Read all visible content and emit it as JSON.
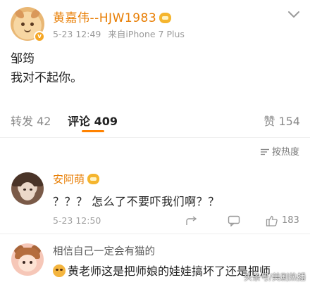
{
  "post": {
    "author_name": "黄嘉伟--HJW1983",
    "timestamp": "5-23 12:49",
    "source": "来自iPhone 7 Plus",
    "body_line1": "邹筠",
    "body_line2": "我对不起你。"
  },
  "action_bar": {
    "repost_label": "转发 42",
    "comment_label": "评论 409",
    "like_label": "赞 154"
  },
  "sort": {
    "label": "按热度"
  },
  "comments": [
    {
      "name": "安阿萌",
      "text": "？？？ 怎么了不要吓我们啊？？",
      "time": "5-23 12:50",
      "like_count": "183"
    },
    {
      "name": "相信自己一定会有猫的",
      "text": "黄老师这是把师娘的娃娃搞坏了还是把师"
    }
  ],
  "watermark": "头条号/美剧热播",
  "colors": {
    "username": "#e87e04",
    "active_tab_indicator": "#ff8200"
  }
}
